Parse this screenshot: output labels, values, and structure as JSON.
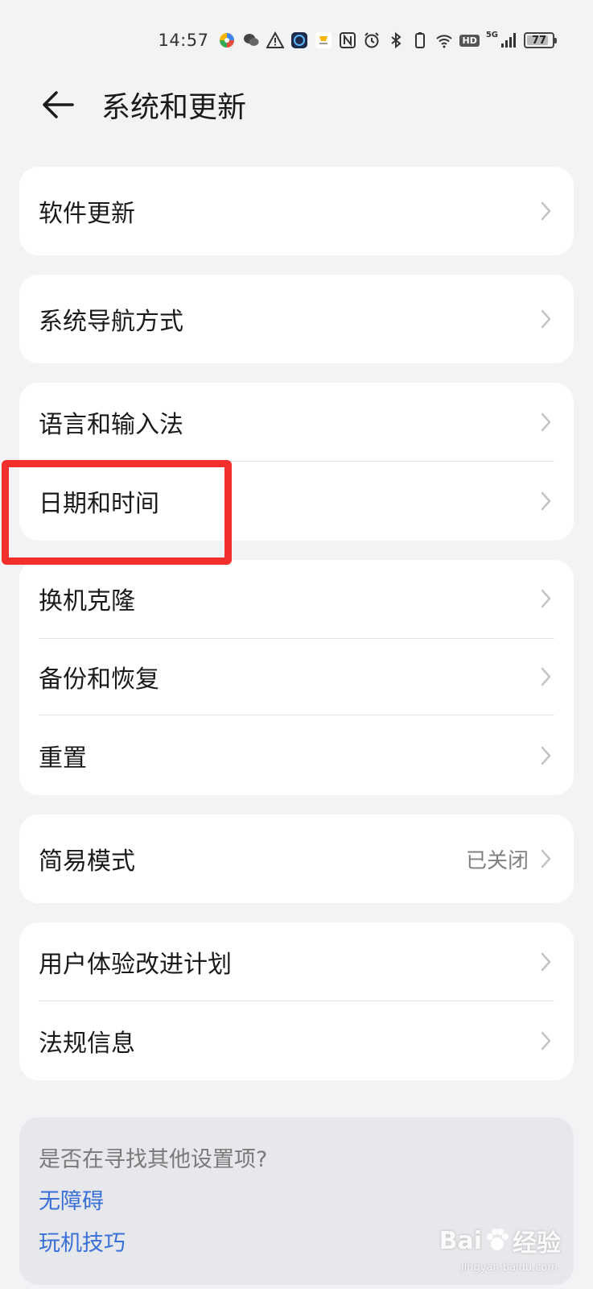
{
  "status_bar": {
    "time": "14:57",
    "five_g": "5G",
    "hd": "HD",
    "battery_percent": "77",
    "icons": [
      "color-ball-app-icon",
      "wechat-icon",
      "warning-icon",
      "app-badge-icon",
      "delivery-app-icon",
      "nfc-icon",
      "alarm-icon",
      "bluetooth-icon",
      "battery-saver-icon",
      "wifi-icon",
      "hd-icon",
      "signal-icon",
      "battery-icon"
    ]
  },
  "header": {
    "title": "系统和更新",
    "back_icon": "arrow-left-icon"
  },
  "cards": {
    "software_update": {
      "label": "软件更新"
    },
    "system_navigation": {
      "label": "系统导航方式"
    },
    "language_input": {
      "label": "语言和输入法"
    },
    "date_time": {
      "label": "日期和时间"
    },
    "phone_clone": {
      "label": "换机克隆"
    },
    "backup_restore": {
      "label": "备份和恢复"
    },
    "reset": {
      "label": "重置"
    },
    "simple_mode": {
      "label": "简易模式",
      "value": "已关闭"
    },
    "user_experience": {
      "label": "用户体验改进计划"
    },
    "regulatory_info": {
      "label": "法规信息"
    }
  },
  "suggestions": {
    "title": "是否在寻找其他设置项?",
    "links": [
      "无障碍",
      "玩机技巧"
    ]
  },
  "watermark": {
    "brand": "Bai",
    "brand_suffix": "经验",
    "url": "jingyan.baidu.com"
  },
  "colors": {
    "background": "#f1f3f5",
    "card": "#ffffff",
    "link": "#3a6fd8",
    "highlight": "#f22f2a"
  }
}
